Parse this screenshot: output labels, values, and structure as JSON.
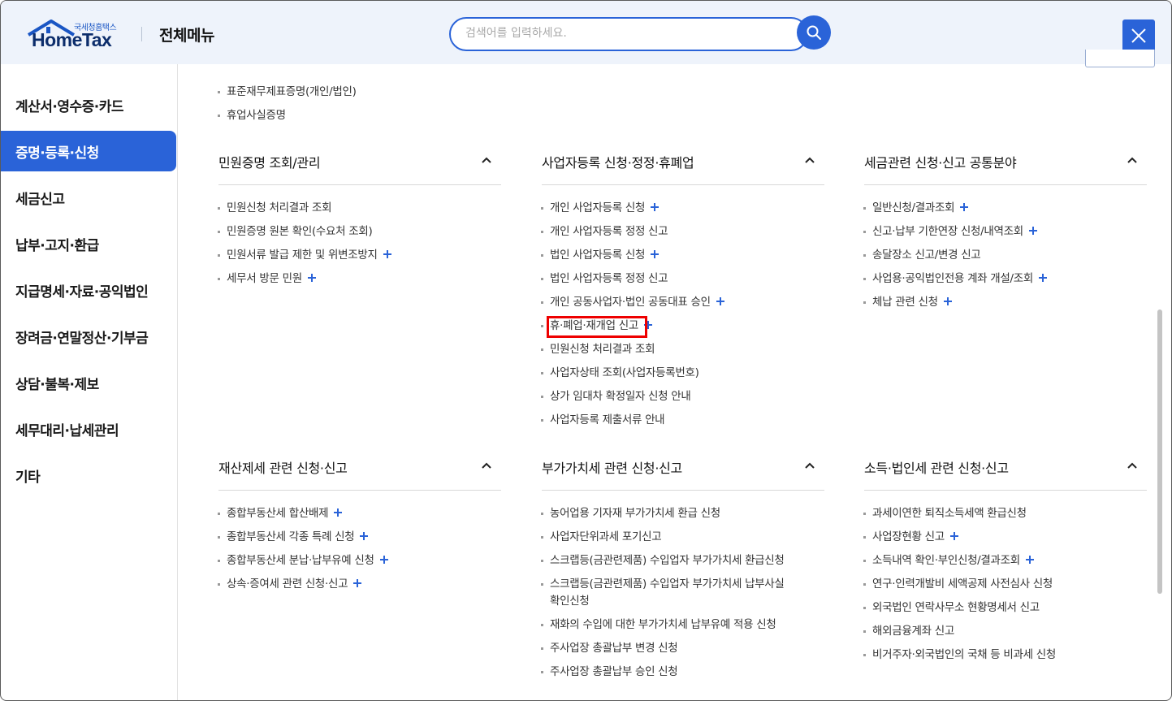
{
  "header": {
    "logo_sub": "국세청홈택스",
    "logo_main": "HomeTax",
    "title": "전체메뉴",
    "search_placeholder": "검색어를 입력하세요.",
    "search_icon": "search-icon",
    "close_icon": "close-icon"
  },
  "colors": {
    "accent": "#2a63d8",
    "highlight": "#ee0000",
    "header_bg": "#eef3fb"
  },
  "sidebar": {
    "items": [
      {
        "label": "계산서·영수증·카드",
        "active": false
      },
      {
        "label": "증명·등록·신청",
        "active": true
      },
      {
        "label": "세금신고",
        "active": false
      },
      {
        "label": "납부·고지·환급",
        "active": false
      },
      {
        "label": "지급명세·자료·공익법인",
        "active": false
      },
      {
        "label": "장려금·연말정산·기부금",
        "active": false
      },
      {
        "label": "상담·불복·제보",
        "active": false
      },
      {
        "label": "세무대리·납세관리",
        "active": false
      },
      {
        "label": "기타",
        "active": false
      }
    ]
  },
  "top_items": [
    "표준재무제표증명(개인/법인)",
    "휴업사실증명"
  ],
  "sections": [
    {
      "title": "민원증명 조회/관리",
      "items": [
        {
          "label": "민원신청 처리결과 조회",
          "plus": false
        },
        {
          "label": "민원증명 원본 확인(수요처 조회)",
          "plus": false
        },
        {
          "label": "민원서류 발급 제한 및 위변조방지",
          "plus": true
        },
        {
          "label": "세무서 방문 민원",
          "plus": true
        }
      ]
    },
    {
      "title": "사업자등록 신청·정정·휴폐업",
      "items": [
        {
          "label": "개인 사업자등록 신청",
          "plus": true
        },
        {
          "label": "개인 사업자등록 정정 신고",
          "plus": false
        },
        {
          "label": "법인 사업자등록 신청",
          "plus": true
        },
        {
          "label": "법인 사업자등록 정정 신고",
          "plus": false
        },
        {
          "label": "개인 공동사업자·법인 공동대표 승인",
          "plus": true
        },
        {
          "label": "휴·폐업·재개업 신고",
          "plus": true
        },
        {
          "label": "민원신청 처리결과 조회",
          "plus": false
        },
        {
          "label": "사업자상태 조회(사업자등록번호)",
          "plus": false
        },
        {
          "label": "상가 임대차 확정일자 신청 안내",
          "plus": false
        },
        {
          "label": "사업자등록 제출서류 안내",
          "plus": false
        }
      ]
    },
    {
      "title": "세금관련 신청·신고 공통분야",
      "items": [
        {
          "label": "일반신청/결과조회",
          "plus": true
        },
        {
          "label": "신고·납부 기한연장 신청/내역조회",
          "plus": true
        },
        {
          "label": "송달장소 신고/변경 신고",
          "plus": false
        },
        {
          "label": "사업용·공익법인전용 계좌 개설/조회",
          "plus": true
        },
        {
          "label": "체납 관련 신청",
          "plus": true
        }
      ]
    },
    {
      "title": "재산제세 관련 신청·신고",
      "items": [
        {
          "label": "종합부동산세 합산배제",
          "plus": true
        },
        {
          "label": "종합부동산세 각종 특례 신청",
          "plus": true
        },
        {
          "label": "종합부동산세 분납·납부유예 신청",
          "plus": true
        },
        {
          "label": "상속·증여세 관련 신청·신고",
          "plus": true
        }
      ]
    },
    {
      "title": "부가가치세 관련 신청·신고",
      "items": [
        {
          "label": "농어업용 기자재 부가가치세 환급 신청",
          "plus": false
        },
        {
          "label": "사업자단위과세 포기신고",
          "plus": false
        },
        {
          "label": "스크랩등(금관련제품) 수입업자 부가가치세 환급신청",
          "plus": false
        },
        {
          "label": "스크랩등(금관련제품) 수입업자 부가가치세 납부사실",
          "label2": "확인신청",
          "plus": false
        },
        {
          "label": "재화의 수입에 대한 부가가치세 납부유예 적용 신청",
          "plus": false
        },
        {
          "label": "주사업장 총괄납부 변경 신청",
          "plus": false
        },
        {
          "label": "주사업장 총괄납부 승인 신청",
          "plus": false
        }
      ]
    },
    {
      "title": "소득·법인세 관련 신청·신고",
      "items": [
        {
          "label": "과세이연한 퇴직소득세액 환급신청",
          "plus": false
        },
        {
          "label": "사업장현황 신고",
          "plus": true
        },
        {
          "label": "소득내역 확인·부인신청/결과조회",
          "plus": true
        },
        {
          "label": "연구·인력개발비 세액공제 사전심사 신청",
          "plus": false
        },
        {
          "label": "외국법인 연락사무소 현황명세서 신고",
          "plus": false
        },
        {
          "label": "해외금융계좌 신고",
          "plus": false
        },
        {
          "label": "비거주자·외국법인의 국채 등 비과세 신청",
          "plus": false
        }
      ]
    }
  ]
}
